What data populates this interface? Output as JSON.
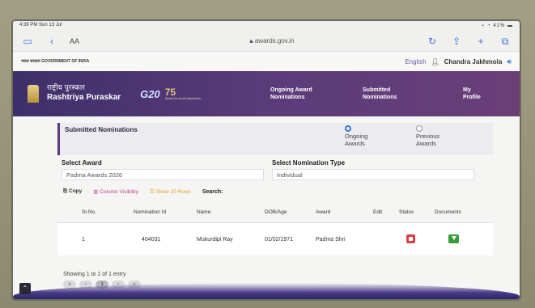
{
  "status_bar": {
    "time": "4:39 PM  Sun 13 Jul",
    "right": "⌁ ◔ 41% ▬"
  },
  "browser": {
    "aa_label": "AA",
    "url": "awards.gov.in",
    "dots": "•••"
  },
  "gov_strip": {
    "gov_text": "भारत सरकार GOVERNMENT OF INDIA",
    "language": "English",
    "user_name": "Chandra Jakhmola"
  },
  "header": {
    "brand_hindi": "राष्ट्रीय पुरस्कार",
    "brand_english": "Rashtriya Puraskar",
    "g20": "G20",
    "azadi": "75",
    "azadi_sub": "Azadi Ka Amrit Mahotsav",
    "nav": [
      {
        "line1": "Ongoing Award",
        "line2": "Nominations"
      },
      {
        "line1": "Submitted",
        "line2": "Nominations"
      },
      {
        "line1": "My",
        "line2": "Profile"
      }
    ]
  },
  "panel": {
    "title": "Submitted Nominations",
    "radio_ongoing": {
      "line1": "Ongoing",
      "line2": "Awards",
      "selected": true
    },
    "radio_previous": {
      "line1": "Previous",
      "line2": "Awards",
      "selected": false
    }
  },
  "filters": {
    "select_award_label": "Select Award",
    "select_award_value": "Padma Awards 2026",
    "select_type_label": "Select Nomination Type",
    "select_type_value": "Individual"
  },
  "table_tools": {
    "copy": "Copy",
    "column_visibility": "Column Visibility",
    "show_rows": "Show 10 Rows",
    "search_label": "Search:"
  },
  "table": {
    "headers": [
      "Sr.No.",
      "Nomination Id",
      "Name",
      "DOB/Age",
      "Award",
      "Edit",
      "Status",
      "Documents"
    ],
    "rows": [
      {
        "sr": "1",
        "nomination_id": "404031",
        "name": "Mukurdipi Ray",
        "dob": "01/02/1971",
        "award": "Padma Shri"
      }
    ]
  },
  "footer": {
    "showing": "Showing 1 to 1 of 1 entry",
    "pages": [
      "«",
      "‹",
      "1",
      "›",
      "»"
    ]
  },
  "colors": {
    "header_purple": "#4a3580",
    "accent_blue": "#3a7bd5",
    "status_red": "#d9404a",
    "doc_green": "#3a9a3a"
  }
}
